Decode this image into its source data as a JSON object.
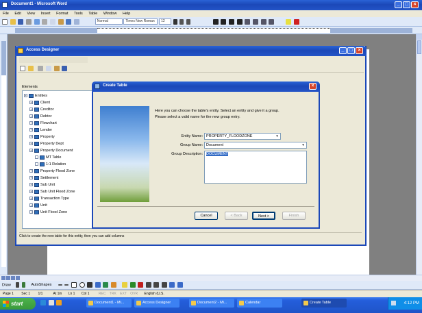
{
  "word": {
    "title": "Document1 - Microsoft Word",
    "menu": [
      "File",
      "Edit",
      "View",
      "Insert",
      "Format",
      "Tools",
      "Table",
      "Window",
      "Help"
    ],
    "style_combo": "Normal",
    "font_combo": "Times New Roman",
    "size_combo": "12",
    "status": [
      "Page 1",
      "Sec 1",
      "1/1",
      "At 1in",
      "Ln 1",
      "Col 1",
      "REC",
      "TRK",
      "EXT",
      "OVR",
      "English (U.S."
    ]
  },
  "designer": {
    "title": "Access Designer",
    "tree_title": "Elements",
    "tree_items": [
      {
        "label": "Entities",
        "depth": 0
      },
      {
        "label": "Client",
        "depth": 1
      },
      {
        "label": "Creditor",
        "depth": 1
      },
      {
        "label": "Debtor",
        "depth": 1
      },
      {
        "label": "Flowchart",
        "depth": 1
      },
      {
        "label": "Lender",
        "depth": 1
      },
      {
        "label": "Property",
        "depth": 1
      },
      {
        "label": "Property Dept",
        "depth": 1
      },
      {
        "label": "Property Document",
        "depth": 1
      },
      {
        "label": "MT Table",
        "depth": 2
      },
      {
        "label": "1:1 Relation",
        "depth": 2
      },
      {
        "label": "Property Flood Zone",
        "depth": 1
      },
      {
        "label": "Settlement",
        "depth": 1
      },
      {
        "label": "Sub Unit",
        "depth": 1
      },
      {
        "label": "Sub Unit Flood Zone",
        "depth": 1
      },
      {
        "label": "Transaction Type",
        "depth": 1
      },
      {
        "label": "Unit",
        "depth": 1
      },
      {
        "label": "Unit Flood Zone",
        "depth": 1
      }
    ],
    "status_text": "Click to create the new table for this entity, then you can add columns"
  },
  "dialog": {
    "title": "Create Table",
    "intro_line1": "Here you can choose the table's entity. Select an entity and give it a group.",
    "intro_line2": "Please select a valid name for the new group entry.",
    "entity_label": "Entity Name:",
    "entity_value": "PROPERTY_FLOODZONE",
    "group_label": "Group Name:",
    "group_value": "Document",
    "desc_label": "Group Description:",
    "desc_value": "DOCUMENT",
    "btn_cancel": "Cancel",
    "btn_back": "< Back",
    "btn_next": "Next >",
    "btn_finish": "Finish"
  },
  "drawing_bar": {
    "draw": "Draw",
    "autoshapes": "AutoShapes"
  },
  "taskbar": {
    "start": "start",
    "buttons": [
      "Document1 - Mi...",
      "Access Designer",
      "Document2 - Mi...",
      "Calendar",
      "Create Table"
    ],
    "clock": "4:12 PM"
  },
  "colors": {
    "xp_blue": "#2a63d6",
    "taskbar": "#245edb",
    "start_green": "#3a9a3a",
    "close_red": "#d6452a"
  }
}
